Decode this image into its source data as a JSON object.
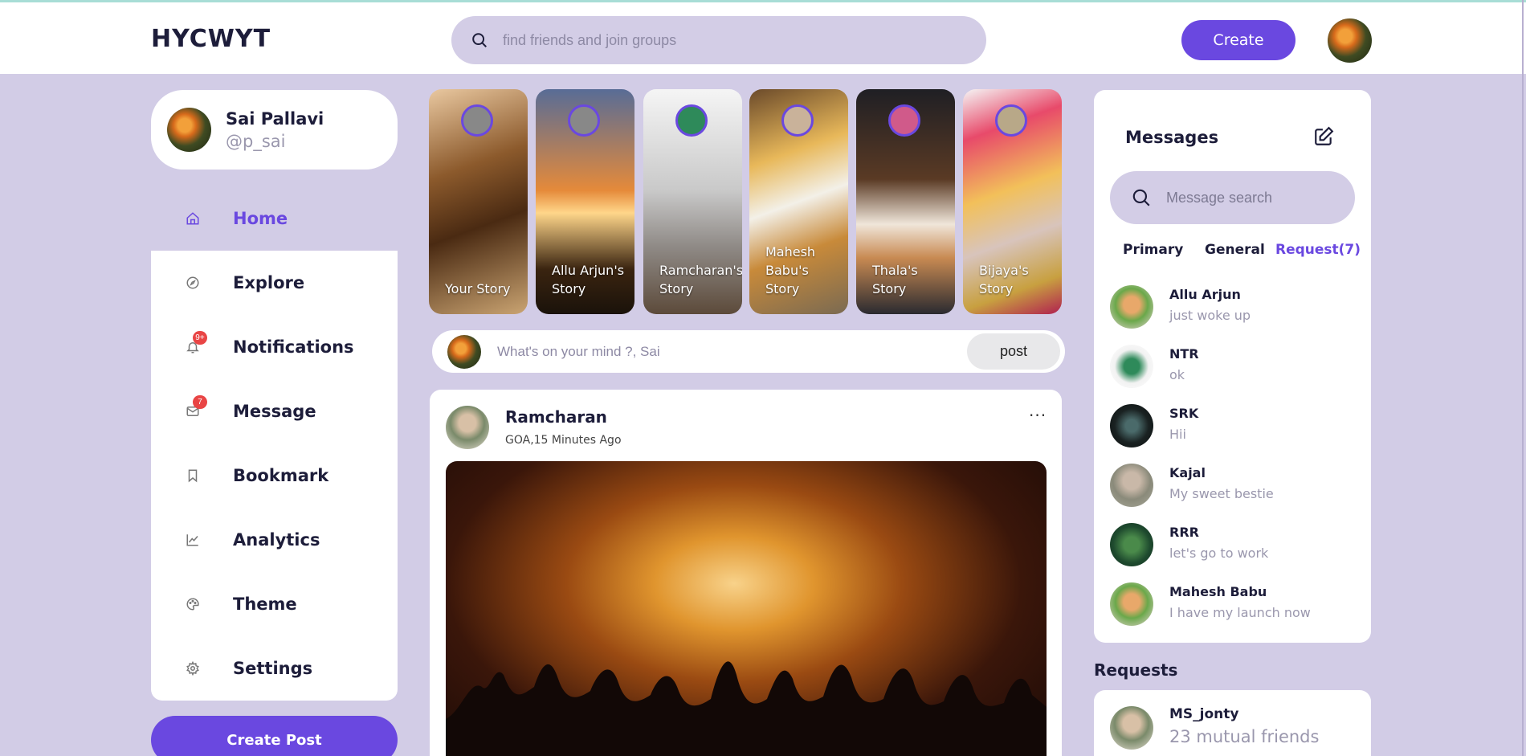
{
  "app": {
    "logo": "HYCWYT"
  },
  "header": {
    "search_placeholder": "find friends and join groups",
    "create_label": "Create",
    "colors": {
      "accent": "#6a48e0",
      "background": "#d2cce6"
    }
  },
  "profile": {
    "name": "Sai Pallavi",
    "handle": "@p_sai"
  },
  "sidebar": {
    "items": [
      {
        "label": "Home",
        "icon": "home-icon",
        "active": true
      },
      {
        "label": "Explore",
        "icon": "compass-icon"
      },
      {
        "label": "Notifications",
        "icon": "bell-icon",
        "badge": "9+"
      },
      {
        "label": "Message",
        "icon": "mail-icon",
        "badge": "7"
      },
      {
        "label": "Bookmark",
        "icon": "bookmark-icon"
      },
      {
        "label": "Analytics",
        "icon": "chart-icon"
      },
      {
        "label": "Theme",
        "icon": "palette-icon"
      },
      {
        "label": "Settings",
        "icon": "gear-icon"
      }
    ],
    "create_post_label": "Create Post"
  },
  "stories": [
    {
      "label": "Your Story"
    },
    {
      "label": "Allu Arjun's Story"
    },
    {
      "label": "Ramcharan's Story"
    },
    {
      "label": "Mahesh Babu's Story"
    },
    {
      "label": "Thala's Story"
    },
    {
      "label": "Bijaya's Story"
    }
  ],
  "composer": {
    "placeholder": "What's on your mind ?, Sai",
    "post_label": "post"
  },
  "feed": {
    "post": {
      "author": "Ramcharan",
      "meta": "GOA,15 Minutes Ago",
      "menu": "···"
    }
  },
  "messages": {
    "title": "Messages",
    "search_placeholder": "Message search",
    "tabs": [
      "Primary",
      "General",
      "Request(7)"
    ],
    "list": [
      {
        "name": "Allu Arjun",
        "text": "just woke up"
      },
      {
        "name": "NTR",
        "text": "ok"
      },
      {
        "name": "SRK",
        "text": "Hii"
      },
      {
        "name": "Kajal",
        "text": "My sweet bestie"
      },
      {
        "name": "RRR",
        "text": "let's go to work"
      },
      {
        "name": "Mahesh Babu",
        "text": "I have my launch now"
      }
    ]
  },
  "requests": {
    "title": "Requests",
    "items": [
      {
        "name": "MS_jonty",
        "mutual": "23 mutual friends"
      }
    ]
  }
}
